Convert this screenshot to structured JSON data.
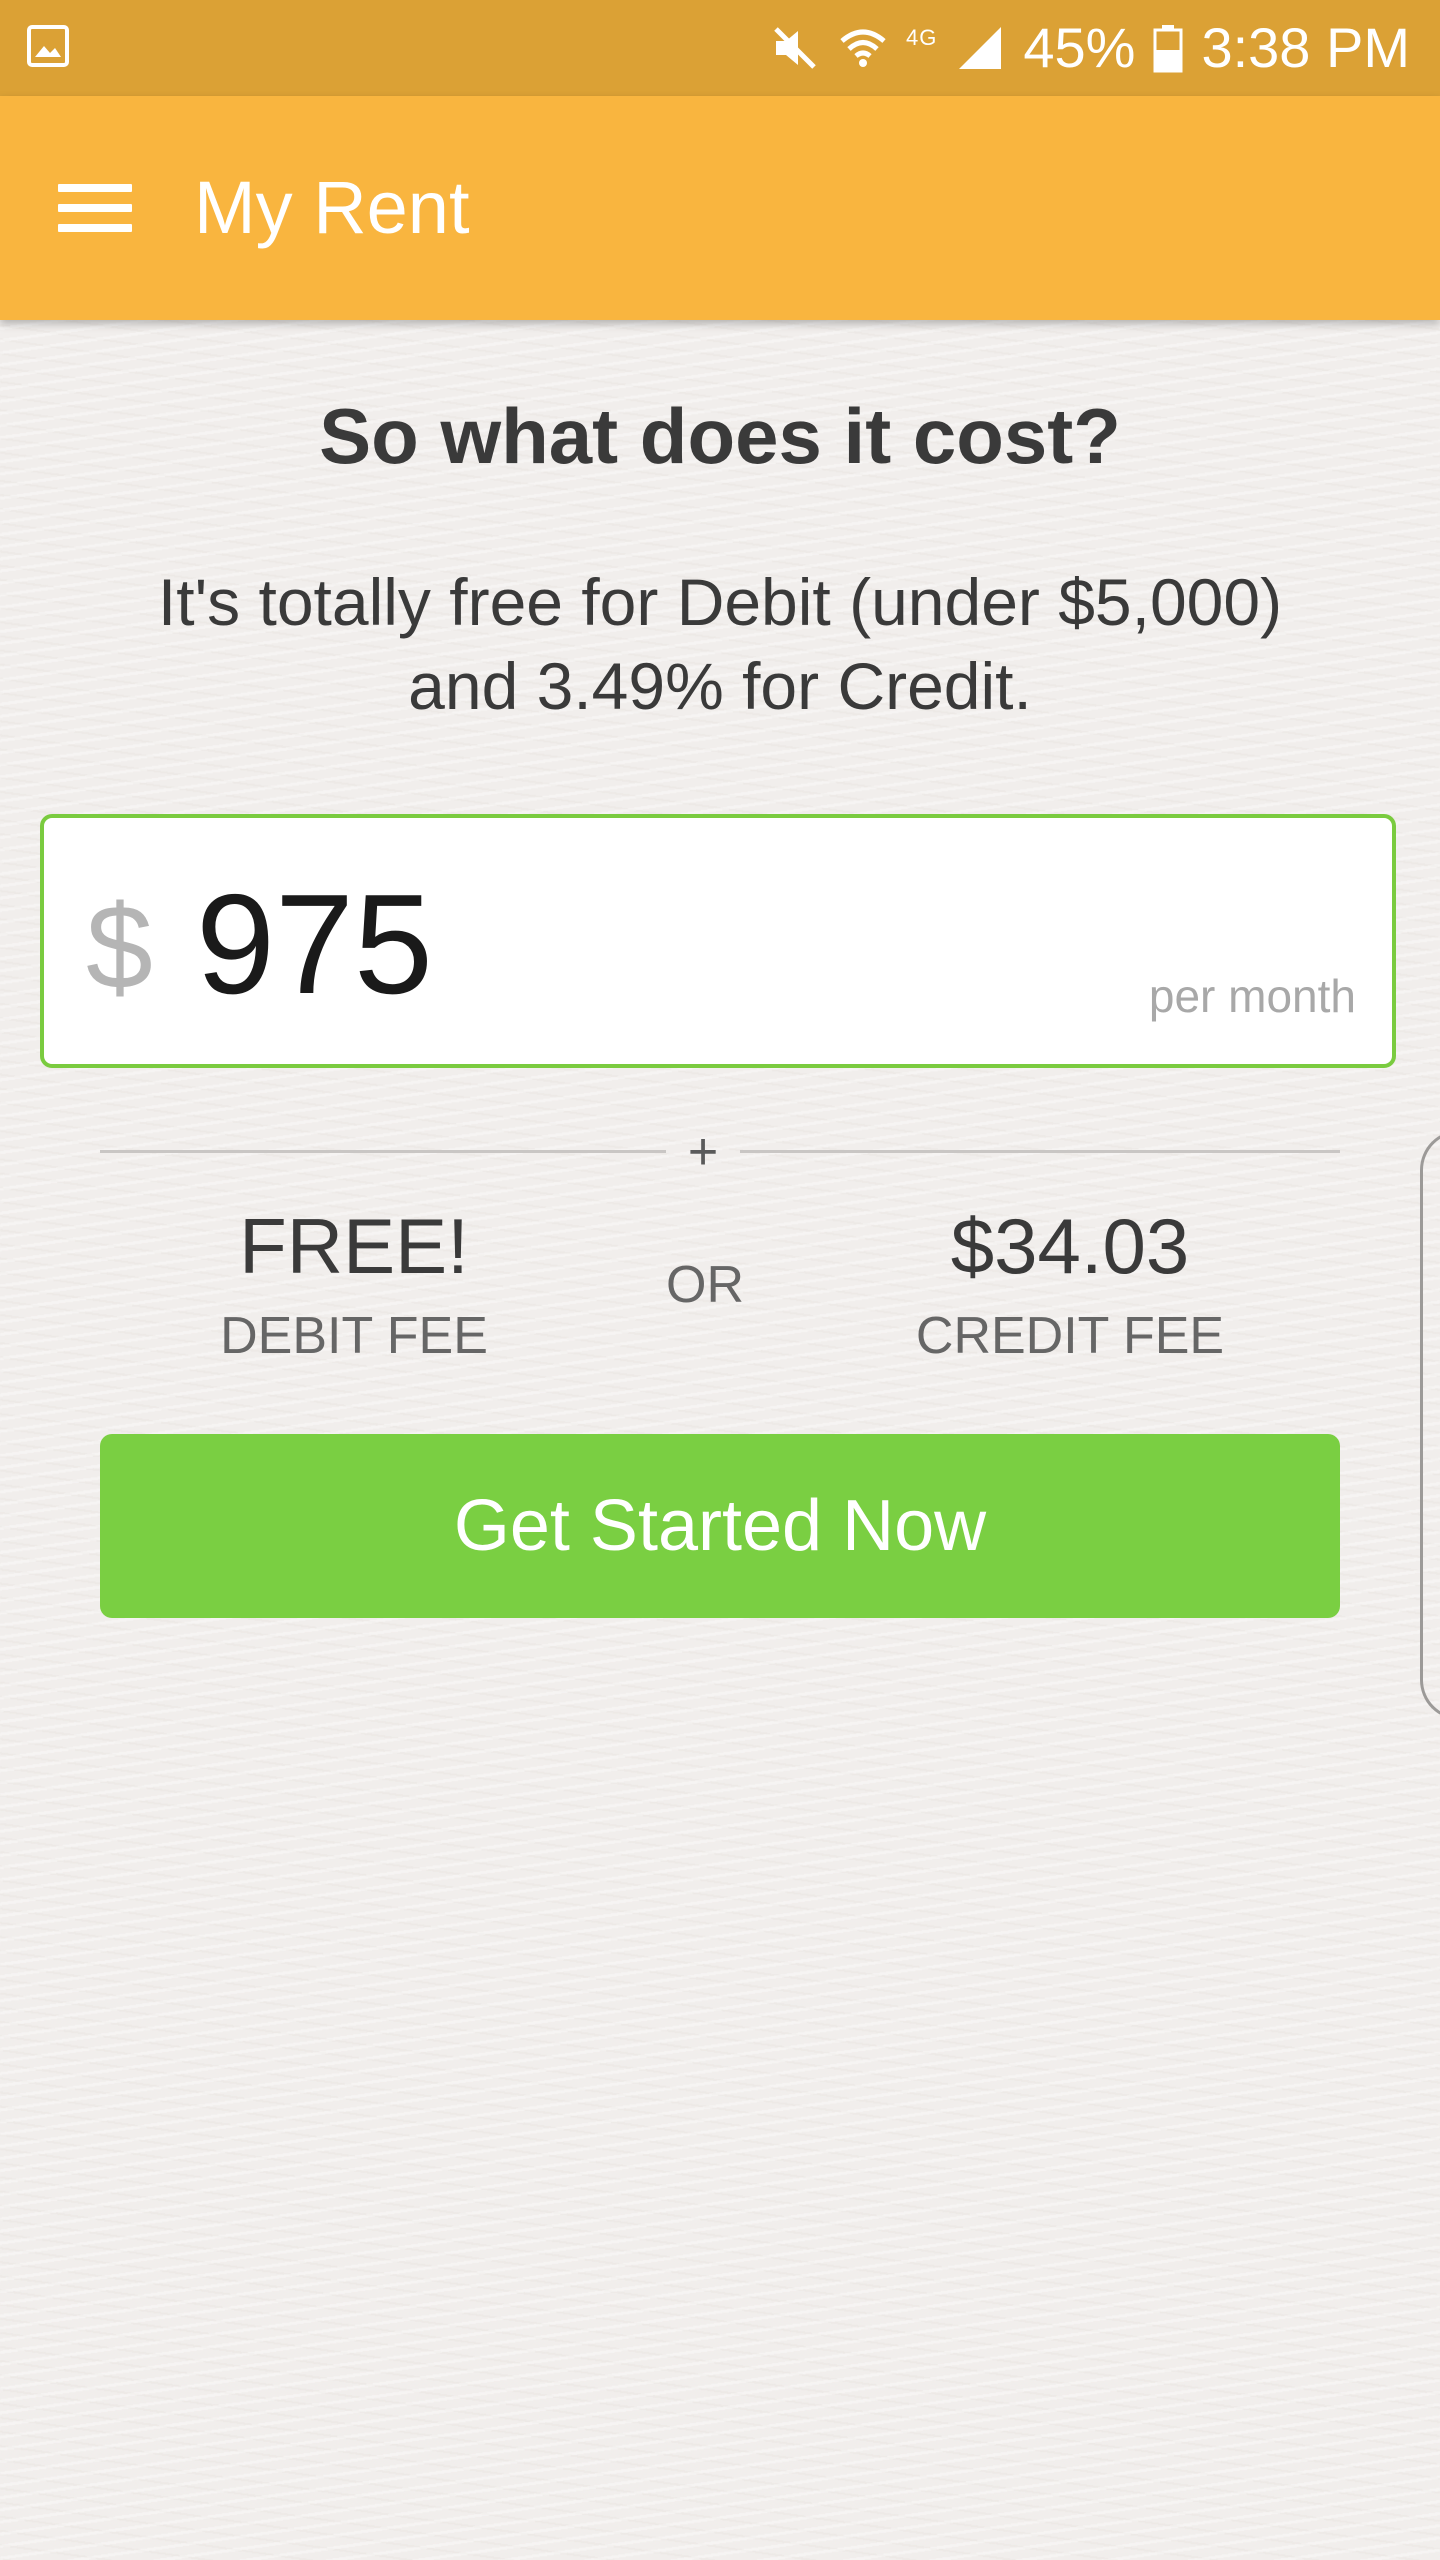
{
  "status_bar": {
    "icons": [
      "gallery-icon",
      "mute-icon",
      "wifi-icon",
      "lte-icon",
      "signal-icon",
      "battery-icon"
    ],
    "lte_label": "4G",
    "battery": "45%",
    "time": "3:38 PM"
  },
  "app_bar": {
    "menu_icon": "hamburger-menu-icon",
    "title": "My Rent"
  },
  "main": {
    "headline": "So what does it cost?",
    "subtext_line1": "It's totally free for Debit (under $5,000)",
    "subtext_line2": "and 3.49% for Credit.",
    "rent_input": {
      "currency": "$",
      "value": "975",
      "suffix": "per month"
    },
    "plus": "+",
    "debit": {
      "amount": "FREE!",
      "label": "DEBIT FEE"
    },
    "or_label": "OR",
    "credit": {
      "amount": "$34.03",
      "label": "CREDIT FEE"
    },
    "cta_label": "Get Started Now"
  },
  "colors": {
    "status_bar": "#dba135",
    "app_bar": "#f9b53f",
    "accent_green": "#7acf42",
    "background": "#f1eeec"
  }
}
